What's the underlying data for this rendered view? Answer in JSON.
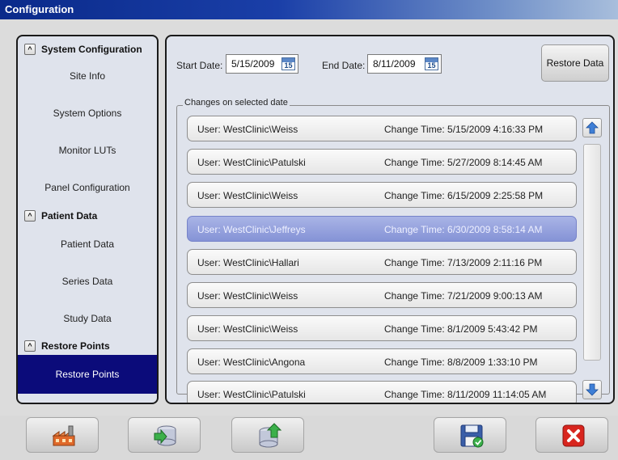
{
  "window": {
    "title": "Configuration"
  },
  "sidebar": {
    "sections": [
      {
        "header": "System Configuration",
        "toggle": "^",
        "items": [
          "Site Info",
          "System Options",
          "Monitor LUTs",
          "Panel Configuration"
        ]
      },
      {
        "header": "Patient Data",
        "toggle": "^",
        "items": [
          "Patient Data",
          "Series Data",
          "Study Data"
        ]
      },
      {
        "header": "Restore Points",
        "toggle": "^",
        "items": [
          "Restore Points"
        ]
      }
    ],
    "selected_item": "Restore Points"
  },
  "filters": {
    "start_label": "Start Date:",
    "start_value": "5/15/2009",
    "end_label": "End Date:",
    "end_value": "8/11/2009",
    "calendar_day": "15"
  },
  "restore_button": {
    "label": "Restore Data"
  },
  "changes": {
    "group_title": "Changes on selected date",
    "items": [
      {
        "user": "User: WestClinic\\Weiss",
        "time": "Change Time: 5/15/2009 4:16:33 PM"
      },
      {
        "user": "User: WestClinic\\Patulski",
        "time": "Change Time: 5/27/2009 8:14:45 AM"
      },
      {
        "user": "User: WestClinic\\Weiss",
        "time": "Change Time: 6/15/2009 2:25:58 PM"
      },
      {
        "user": "User: WestClinic\\Jeffreys",
        "time": "Change Time: 6/30/2009 8:58:14 AM"
      },
      {
        "user": "User: WestClinic\\Hallari",
        "time": "Change Time: 7/13/2009 2:11:16 PM"
      },
      {
        "user": "User: WestClinic\\Weiss",
        "time": "Change Time: 7/21/2009 9:00:13 AM"
      },
      {
        "user": "User: WestClinic\\Weiss",
        "time": "Change Time: 8/1/2009 5:43:42 PM"
      },
      {
        "user": "User: WestClinic\\Angona",
        "time": "Change Time: 8/8/2009 1:33:10 PM"
      },
      {
        "user": "User: WestClinic\\Patulski",
        "time": "Change Time: 8/11/2009 11:14:05 AM"
      }
    ],
    "selected_index": 3
  },
  "toolbar": {
    "buttons": [
      {
        "name": "factory-icon"
      },
      {
        "name": "database-import-icon"
      },
      {
        "name": "database-export-icon"
      },
      {
        "name": "save-icon"
      },
      {
        "name": "close-icon"
      }
    ]
  },
  "colors": {
    "selected_nav": "#0b0b7a",
    "selected_row": "#8593d6",
    "title_bar": "#0a2a8a"
  }
}
